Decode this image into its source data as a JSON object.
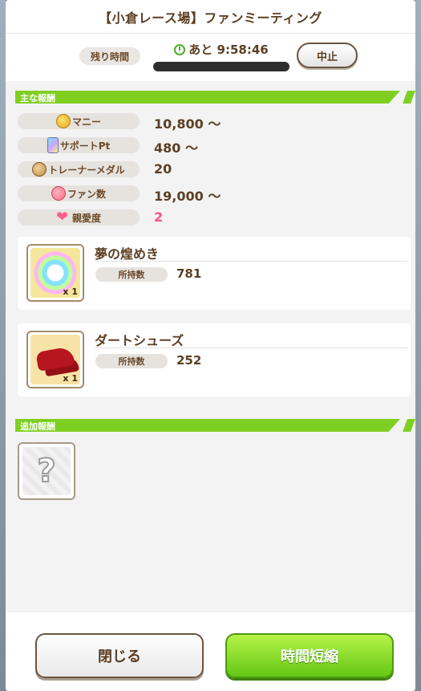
{
  "dialog": {
    "title": "【小倉レース場】ファンミーティング"
  },
  "timer": {
    "remain_label": "残り時間",
    "time_text": "あと 9:58:46",
    "stop_label": "中止"
  },
  "main_rewards": {
    "header": "主な報酬",
    "rows": [
      {
        "label": "マニー",
        "value": "10,800 ～",
        "icon": "coin-icon"
      },
      {
        "label": "サポートPt",
        "value": "480 ～",
        "icon": "support-card-icon"
      },
      {
        "label": "トレーナーメダル",
        "value": "20",
        "icon": "trainer-medal-icon"
      },
      {
        "label": "ファン数",
        "value": "19,000 ～",
        "icon": "fan-icon"
      },
      {
        "label": "親愛度",
        "value": "2",
        "icon": "heart-icon"
      }
    ],
    "items": [
      {
        "name": "夢の煌めき",
        "qty": "x 1",
        "own_label": "所持数",
        "own_value": "781"
      },
      {
        "name": "ダートシューズ",
        "qty": "x 1",
        "own_label": "所持数",
        "own_value": "252"
      }
    ]
  },
  "additional_rewards": {
    "header": "追加報酬",
    "slot_symbol": "?"
  },
  "buttons": {
    "close_label": "閉じる",
    "shorten_label": "時間短縮"
  }
}
